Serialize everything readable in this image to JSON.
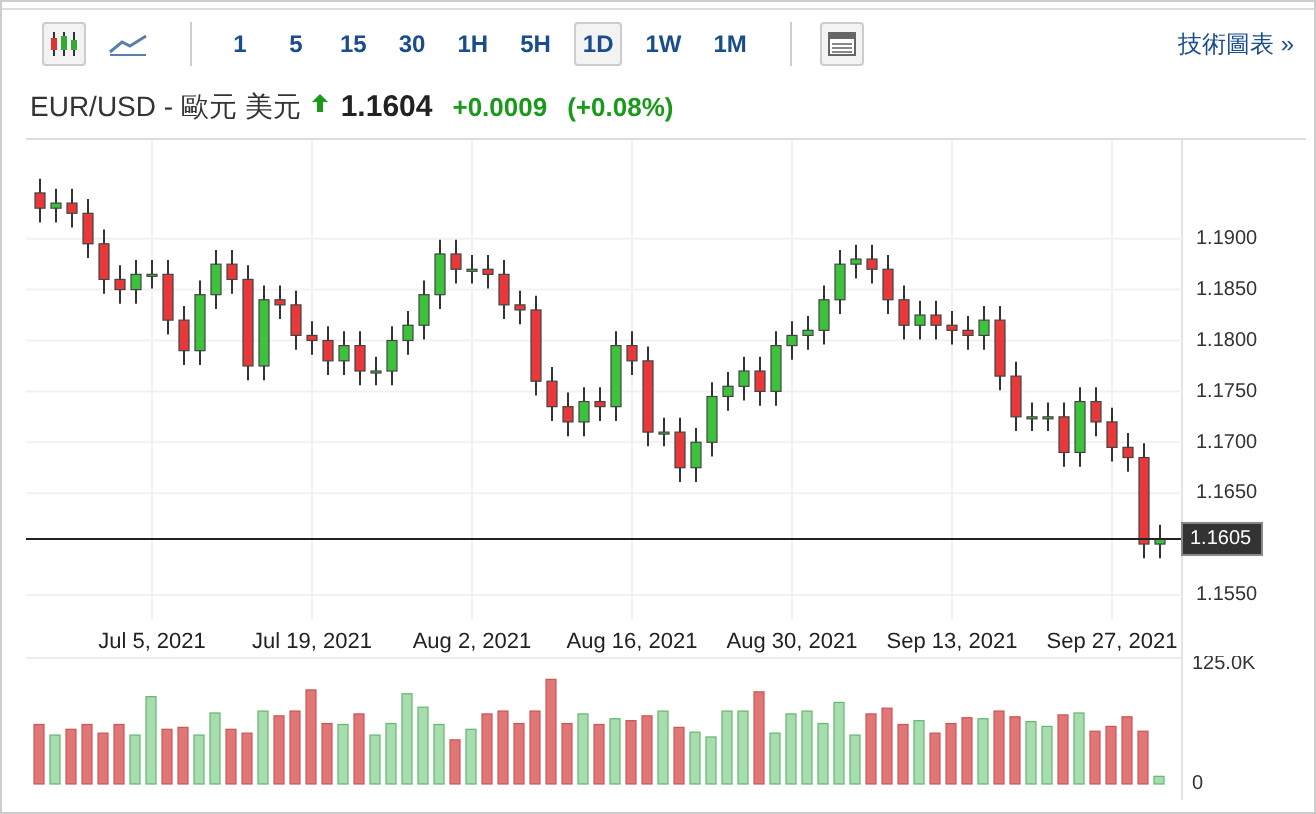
{
  "toolbar": {
    "chart_types": [
      {
        "kind": "candles",
        "selected": true
      },
      {
        "kind": "line",
        "selected": false
      }
    ],
    "intervals": [
      {
        "label": "1",
        "selected": false
      },
      {
        "label": "5",
        "selected": false
      },
      {
        "label": "15",
        "selected": false
      },
      {
        "label": "30",
        "selected": false
      },
      {
        "label": "1H",
        "selected": false
      },
      {
        "label": "5H",
        "selected": false
      },
      {
        "label": "1D",
        "selected": true
      },
      {
        "label": "1W",
        "selected": false
      },
      {
        "label": "1M",
        "selected": false
      }
    ],
    "link": "技術圖表 »"
  },
  "quote": {
    "symbol": "EUR/USD - 歐元 美元",
    "rising": true,
    "price": "1.1604",
    "change": "+0.0009",
    "change_percent": "(+0.08%)"
  },
  "price_chart": {
    "chart_data": {
      "type": "candlestick",
      "grid": true,
      "ylim": [
        1.149,
        1.1997
      ],
      "yticks": [
        {
          "value": 1.155,
          "label": "1.1550"
        },
        {
          "value": 1.165,
          "label": "1.1650"
        },
        {
          "value": 1.17,
          "label": "1.1700"
        },
        {
          "value": 1.175,
          "label": "1.1750"
        },
        {
          "value": 1.18,
          "label": "1.1800"
        },
        {
          "value": 1.185,
          "label": "1.1850"
        },
        {
          "value": 1.19,
          "label": "1.1900"
        }
      ],
      "categories": [
        null,
        null,
        null,
        null,
        null,
        null,
        null,
        "Jul 5, 2021",
        null,
        null,
        null,
        null,
        null,
        null,
        null,
        null,
        null,
        "Jul 19, 2021",
        null,
        null,
        null,
        null,
        null,
        null,
        null,
        null,
        null,
        "Aug 2, 2021",
        null,
        null,
        null,
        null,
        null,
        null,
        null,
        null,
        null,
        "Aug 16, 2021",
        null,
        null,
        null,
        null,
        null,
        null,
        null,
        null,
        null,
        "Aug 30, 2021",
        null,
        null,
        null,
        null,
        null,
        null,
        null,
        null,
        null,
        "Sep 13, 2021",
        null,
        null,
        null,
        null,
        null,
        null,
        null,
        null,
        null,
        "Sep 27, 2021",
        null,
        null,
        null
      ],
      "ref_lines": [
        {
          "axis": "y",
          "value": 1.1605,
          "label": "1.1605"
        }
      ],
      "ohlc": [
        [
          1.1945,
          1.1959,
          1.1916,
          1.193
        ],
        [
          1.193,
          1.1949,
          1.1916,
          1.1935
        ],
        [
          1.1935,
          1.1949,
          1.1911,
          1.1925
        ],
        [
          1.1925,
          1.1939,
          1.1881,
          1.1895
        ],
        [
          1.1895,
          1.1909,
          1.1846,
          1.186
        ],
        [
          1.186,
          1.1874,
          1.1836,
          1.185
        ],
        [
          1.185,
          1.1879,
          1.1836,
          1.1865
        ],
        [
          1.1865,
          1.1879,
          1.1851,
          1.1865
        ],
        [
          1.1865,
          1.1879,
          1.1806,
          1.182
        ],
        [
          1.182,
          1.1834,
          1.1776,
          1.179
        ],
        [
          1.179,
          1.1859,
          1.1776,
          1.1845
        ],
        [
          1.1845,
          1.1889,
          1.1831,
          1.1875
        ],
        [
          1.1875,
          1.1889,
          1.1846,
          1.186
        ],
        [
          1.186,
          1.1874,
          1.1761,
          1.1775
        ],
        [
          1.1775,
          1.1854,
          1.1761,
          1.184
        ],
        [
          1.184,
          1.1854,
          1.1821,
          1.1835
        ],
        [
          1.1835,
          1.1849,
          1.1791,
          1.1805
        ],
        [
          1.1805,
          1.1819,
          1.1786,
          1.18
        ],
        [
          1.18,
          1.1814,
          1.1766,
          1.178
        ],
        [
          1.178,
          1.1809,
          1.1766,
          1.1795
        ],
        [
          1.1795,
          1.1809,
          1.1756,
          1.177
        ],
        [
          1.177,
          1.1784,
          1.1756,
          1.177
        ],
        [
          1.177,
          1.1814,
          1.1756,
          1.18
        ],
        [
          1.18,
          1.1829,
          1.1786,
          1.1815
        ],
        [
          1.1815,
          1.1859,
          1.1801,
          1.1845
        ],
        [
          1.1845,
          1.1899,
          1.1831,
          1.1885
        ],
        [
          1.1885,
          1.1899,
          1.1856,
          1.187
        ],
        [
          1.187,
          1.1884,
          1.1856,
          1.187
        ],
        [
          1.187,
          1.1884,
          1.1851,
          1.1865
        ],
        [
          1.1865,
          1.1879,
          1.1821,
          1.1835
        ],
        [
          1.1835,
          1.1849,
          1.1816,
          1.183
        ],
        [
          1.183,
          1.1844,
          1.1746,
          1.176
        ],
        [
          1.176,
          1.1774,
          1.1721,
          1.1735
        ],
        [
          1.1735,
          1.1749,
          1.1706,
          1.172
        ],
        [
          1.172,
          1.1754,
          1.1706,
          1.174
        ],
        [
          1.174,
          1.1754,
          1.1721,
          1.1735
        ],
        [
          1.1735,
          1.1809,
          1.1721,
          1.1795
        ],
        [
          1.1795,
          1.1809,
          1.1766,
          1.178
        ],
        [
          1.178,
          1.1794,
          1.1696,
          1.171
        ],
        [
          1.171,
          1.1724,
          1.1696,
          1.171
        ],
        [
          1.171,
          1.1724,
          1.1661,
          1.1675
        ],
        [
          1.1675,
          1.1714,
          1.1661,
          1.17
        ],
        [
          1.17,
          1.1759,
          1.1686,
          1.1745
        ],
        [
          1.1745,
          1.1769,
          1.1731,
          1.1755
        ],
        [
          1.1755,
          1.1784,
          1.1741,
          1.177
        ],
        [
          1.177,
          1.1784,
          1.1736,
          1.175
        ],
        [
          1.175,
          1.1809,
          1.1736,
          1.1795
        ],
        [
          1.1795,
          1.1819,
          1.1781,
          1.1805
        ],
        [
          1.1805,
          1.1824,
          1.1791,
          1.181
        ],
        [
          1.181,
          1.1854,
          1.1796,
          1.184
        ],
        [
          1.184,
          1.1889,
          1.1826,
          1.1875
        ],
        [
          1.1875,
          1.1894,
          1.1861,
          1.188
        ],
        [
          1.188,
          1.1894,
          1.1856,
          1.187
        ],
        [
          1.187,
          1.1884,
          1.1826,
          1.184
        ],
        [
          1.184,
          1.1854,
          1.1801,
          1.1815
        ],
        [
          1.1815,
          1.1839,
          1.1801,
          1.1825
        ],
        [
          1.1825,
          1.1839,
          1.1801,
          1.1815
        ],
        [
          1.1815,
          1.1829,
          1.1796,
          1.181
        ],
        [
          1.181,
          1.1824,
          1.1791,
          1.1805
        ],
        [
          1.1805,
          1.1834,
          1.1791,
          1.182
        ],
        [
          1.182,
          1.1834,
          1.1751,
          1.1765
        ],
        [
          1.1765,
          1.1779,
          1.1711,
          1.1725
        ],
        [
          1.1725,
          1.1739,
          1.1711,
          1.1725
        ],
        [
          1.1725,
          1.1739,
          1.1711,
          1.1725
        ],
        [
          1.1725,
          1.1739,
          1.1676,
          1.169
        ],
        [
          1.169,
          1.1754,
          1.1676,
          1.174
        ],
        [
          1.174,
          1.1754,
          1.1706,
          1.172
        ],
        [
          1.172,
          1.1734,
          1.1681,
          1.1695
        ],
        [
          1.1695,
          1.1709,
          1.1671,
          1.1685
        ],
        [
          1.1685,
          1.1699,
          1.1586,
          1.16
        ],
        [
          1.16,
          1.1619,
          1.1586,
          1.1605
        ]
      ]
    }
  },
  "volume_chart": {
    "chart_data": {
      "type": "bar",
      "ylim": [
        0,
        125000
      ],
      "yticks": [
        {
          "value": 0,
          "label": "0"
        },
        {
          "value": 125000,
          "label": "125.0K"
        }
      ],
      "categories": [
        null,
        null,
        null,
        null,
        null,
        null,
        null,
        null,
        null,
        null,
        null,
        null,
        null,
        null,
        null,
        null,
        null,
        null,
        null,
        null,
        null,
        null,
        null,
        null,
        null,
        null,
        null,
        null,
        null,
        null,
        null,
        null,
        null,
        null,
        null,
        null,
        null,
        null,
        null,
        null,
        null,
        null,
        null,
        null,
        null,
        null,
        null,
        null,
        null,
        null,
        null,
        null,
        null,
        null,
        null,
        null,
        null,
        null,
        null,
        null,
        null,
        null,
        null,
        null,
        null,
        null,
        null,
        null,
        null,
        null,
        null
      ],
      "values": [
        62000,
        51000,
        57000,
        62000,
        53000,
        62000,
        51000,
        91000,
        57000,
        59000,
        51000,
        74000,
        57000,
        53000,
        76000,
        71000,
        76000,
        98000,
        63000,
        62000,
        73000,
        51000,
        63000,
        94000,
        80000,
        62000,
        46000,
        57000,
        73000,
        76000,
        63000,
        76000,
        109000,
        63000,
        73000,
        62000,
        68000,
        66000,
        71000,
        76000,
        59000,
        54000,
        49000,
        76000,
        76000,
        96000,
        53000,
        73000,
        76000,
        63000,
        85000,
        51000,
        73000,
        79000,
        62000,
        66000,
        53000,
        63000,
        69000,
        68000,
        76000,
        70000,
        65000,
        60000,
        72000,
        74000,
        55000,
        60000,
        70000,
        55000,
        8000
      ]
    }
  }
}
